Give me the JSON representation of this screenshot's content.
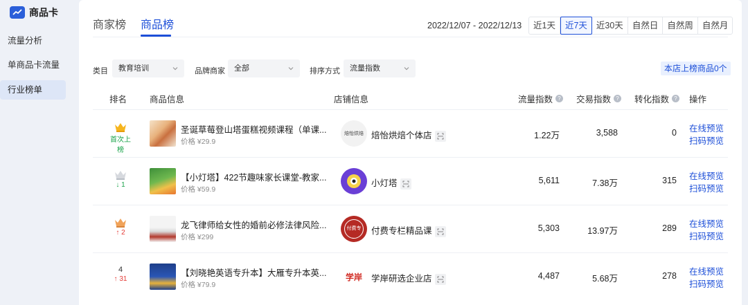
{
  "brand": {
    "title": "商品卡"
  },
  "sidebar": {
    "items": [
      {
        "label": "流量分析"
      },
      {
        "label": "单商品卡流量"
      },
      {
        "label": "行业榜单"
      }
    ]
  },
  "tabs": [
    {
      "label": "商家榜"
    },
    {
      "label": "商品榜"
    }
  ],
  "date_range": "2022/12/07 - 2022/12/13",
  "range_buttons": [
    "近1天",
    "近7天",
    "近30天",
    "自然日",
    "自然周",
    "自然月"
  ],
  "filters": {
    "category": {
      "label": "类目",
      "value": "教育培训"
    },
    "brand": {
      "label": "品牌商家",
      "value": "全部"
    },
    "sort": {
      "label": "排序方式",
      "value": "流量指数"
    }
  },
  "store_badge": "本店上榜商品0个",
  "columns": {
    "rank": "排名",
    "product": "商品信息",
    "shop": "店铺信息",
    "traffic": "流量指数",
    "trade": "交易指数",
    "conversion": "转化指数",
    "action": "操作"
  },
  "rows": [
    {
      "rank": "",
      "rank_change": "首次上榜",
      "product": "圣诞草莓登山塔蛋糕视频课程（单课...",
      "price": "价格 ¥29.9",
      "shop": "焙怡烘焙个体店",
      "shop_logo_text": "焙怡烘焙",
      "traffic": "1.22万",
      "trade": "3,588",
      "conversion": "0",
      "preview": "在线预览",
      "scan": "扫码预览"
    },
    {
      "rank": "",
      "rank_change": "↓ 1",
      "product": "【小灯塔】422节趣味家长课堂-教家...",
      "price": "价格 ¥59.9",
      "shop": "小灯塔",
      "traffic": "5,611",
      "trade": "7.38万",
      "conversion": "315",
      "preview": "在线预览",
      "scan": "扫码预览"
    },
    {
      "rank": "",
      "rank_change": "↑ 2",
      "product": "龙飞律师给女性的婚前必修法律风险...",
      "price": "价格 ¥299",
      "shop": "付费专栏精品课",
      "shop_logo_text": "付费专栏",
      "traffic": "5,303",
      "trade": "13.97万",
      "conversion": "289",
      "preview": "在线预览",
      "scan": "扫码预览"
    },
    {
      "rank": "4",
      "rank_change": "↑ 31",
      "product": "【刘晓艳英语专升本】大雁专升本英...",
      "price": "价格 ¥79.9",
      "shop": "学岸研选企业店",
      "shop_logo_text": "学岸",
      "traffic": "4,487",
      "trade": "5.68万",
      "conversion": "278",
      "preview": "在线预览",
      "scan": "扫码预览"
    }
  ],
  "colors": {
    "accent": "#1d4fd8",
    "up": "#e53935",
    "down": "#1aa34a"
  }
}
